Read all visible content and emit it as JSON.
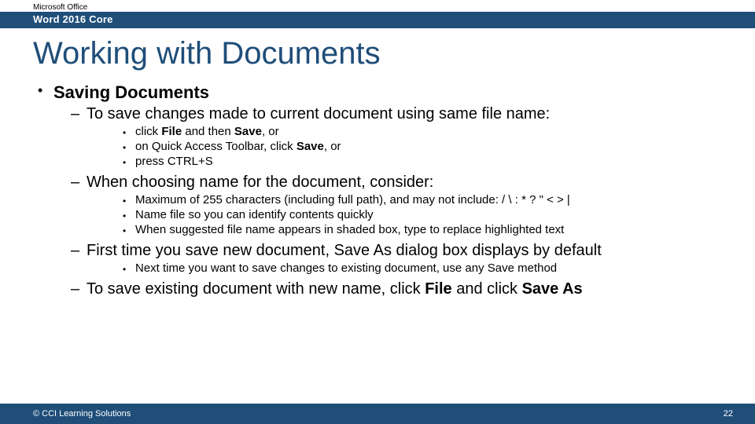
{
  "header": {
    "brand": "Microsoft Office",
    "product": "Word 2016 Core"
  },
  "title": "Working with Documents",
  "bullet": {
    "main": "Saving Documents",
    "subs": [
      {
        "text": "To save changes made to current document using same file name:",
        "items": [
          {
            "pre": "click ",
            "b1": "File",
            "mid": " and then ",
            "b2": "Save",
            "post": ", or"
          },
          {
            "pre": "on Quick Access Toolbar, click ",
            "b1": "Save",
            "mid": "",
            "b2": "",
            "post": ", or"
          },
          {
            "pre": "press CTRL+S",
            "b1": "",
            "mid": "",
            "b2": "",
            "post": ""
          }
        ]
      },
      {
        "text": "When choosing name for the document, consider:",
        "items": [
          {
            "pre": "Maximum of 255 characters (including full path), and may not include: / \\ : * ? \" < > |",
            "b1": "",
            "mid": "",
            "b2": "",
            "post": ""
          },
          {
            "pre": "Name file so you can identify contents quickly",
            "b1": "",
            "mid": "",
            "b2": "",
            "post": ""
          },
          {
            "pre": "When suggested file name appears in shaded box, type to replace highlighted text",
            "b1": "",
            "mid": "",
            "b2": "",
            "post": ""
          }
        ]
      },
      {
        "text": "First time you save new document, Save As dialog box displays by default",
        "items": [
          {
            "pre": "Next time you want to save changes to existing document, use any Save method",
            "b1": "",
            "mid": "",
            "b2": "",
            "post": ""
          }
        ]
      },
      {
        "rich": {
          "pre": "To save existing document with new name, click ",
          "b1": "File",
          "mid": " and click ",
          "b2": "Save As",
          "post": ""
        },
        "items": []
      }
    ]
  },
  "footer": {
    "copyright": "© CCI Learning Solutions",
    "page": "22"
  }
}
